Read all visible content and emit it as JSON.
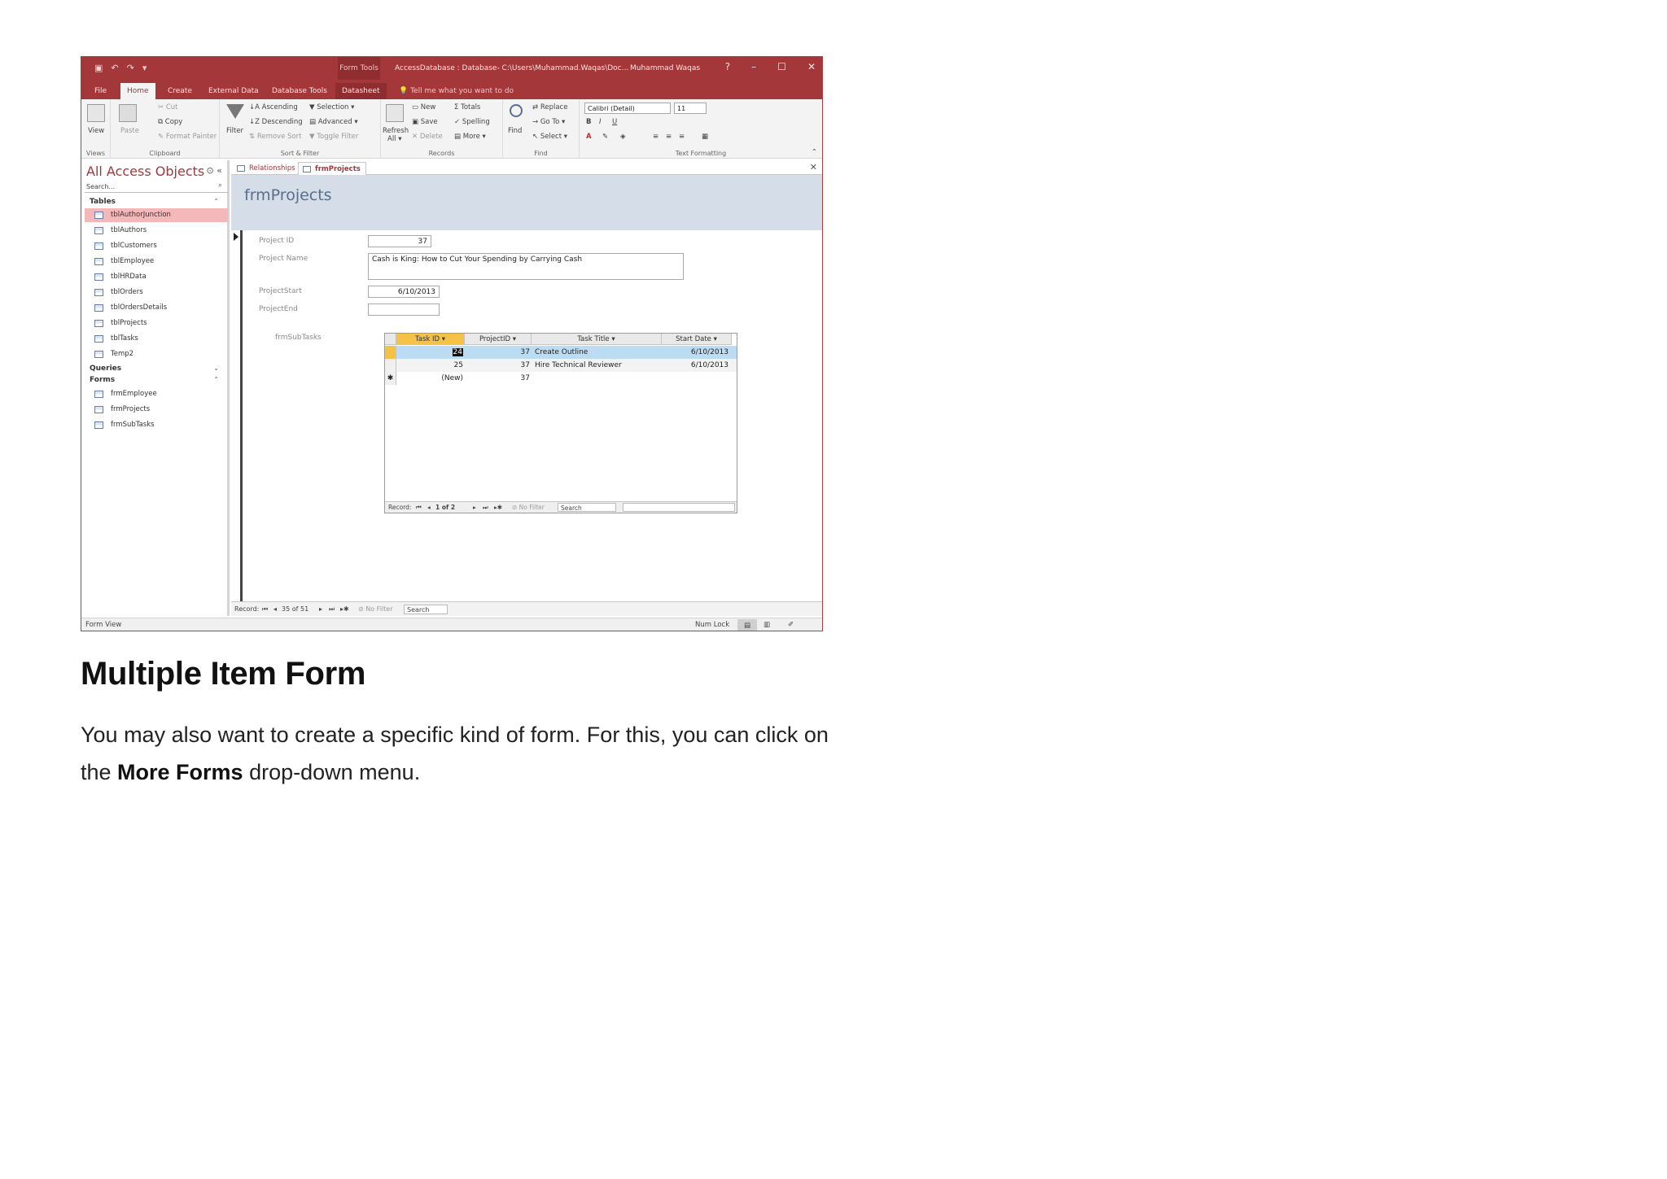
{
  "window": {
    "context_tab": "Form Tools",
    "title": "AccessDatabase : Database- C:\\Users\\Muhammad.Waqas\\Doc...",
    "user": "Muhammad Waqas",
    "help": "?",
    "minimize": "–",
    "maximize": "☐",
    "close": "✕"
  },
  "tabs": [
    {
      "label": "File"
    },
    {
      "label": "Home"
    },
    {
      "label": "Create"
    },
    {
      "label": "External Data"
    },
    {
      "label": "Database Tools"
    },
    {
      "label": "Datasheet"
    }
  ],
  "tell_me": "Tell me what you want to do",
  "ribbon": {
    "views": {
      "view": "View",
      "group": "Views"
    },
    "clipboard": {
      "paste": "Paste",
      "cut": "Cut",
      "copy": "Copy",
      "format_painter": "Format Painter",
      "group": "Clipboard"
    },
    "sort_filter": {
      "filter": "Filter",
      "ascending": "Ascending",
      "descending": "Descending",
      "remove_sort": "Remove Sort",
      "selection": "Selection ▾",
      "advanced": "Advanced ▾",
      "toggle_filter": "Toggle Filter",
      "group": "Sort & Filter"
    },
    "records": {
      "refresh": "Refresh",
      "refresh_all": "All ▾",
      "new": "New",
      "save": "Save",
      "delete": "Delete",
      "totals": "Totals",
      "spelling": "Spelling",
      "more": "More ▾",
      "group": "Records"
    },
    "find": {
      "find": "Find",
      "replace": "Replace",
      "go_to": "Go To ▾",
      "select": "Select ▾",
      "group": "Find"
    },
    "text_formatting": {
      "font": "Calibri (Detail)",
      "size": "11",
      "group": "Text Formatting"
    }
  },
  "nav": {
    "title": "All Access Objects",
    "search_placeholder": "Search...",
    "sections": {
      "tables": "Tables",
      "queries": "Queries",
      "forms": "Forms"
    },
    "tables": [
      "tblAuthorJunction",
      "tblAuthors",
      "tblCustomers",
      "tblEmployee",
      "tblHRData",
      "tblOrders",
      "tblOrdersDetails",
      "tblProjects",
      "tblTasks",
      "Temp2"
    ],
    "forms": [
      "frmEmployee",
      "frmProjects",
      "frmSubTasks"
    ]
  },
  "doc_tabs": [
    "Relationships",
    "frmProjects"
  ],
  "form": {
    "title": "frmProjects",
    "labels": {
      "project_id": "Project ID",
      "project_name": "Project Name",
      "project_start": "ProjectStart",
      "project_end": "ProjectEnd",
      "subform": "frmSubTasks"
    },
    "values": {
      "project_id": "37",
      "project_name": "Cash is King: How to Cut Your Spending by Carrying Cash",
      "project_start": "6/10/2013",
      "project_end": ""
    }
  },
  "subform": {
    "columns": [
      "Task ID",
      "ProjectID",
      "Task Title",
      "Start Date"
    ],
    "rows": [
      {
        "task_id": "24",
        "project_id": "37",
        "title": "Create Outline",
        "start": "6/10/2013"
      },
      {
        "task_id": "25",
        "project_id": "37",
        "title": "Hire Technical Reviewer",
        "start": "6/10/2013"
      },
      {
        "task_id": "(New)",
        "project_id": "37",
        "title": "",
        "start": ""
      }
    ],
    "nav": {
      "record": "Record:",
      "position": "1 of 2",
      "filter": "No Filter",
      "search": "Search"
    }
  },
  "record_nav": {
    "record": "Record:",
    "position": "35 of 51",
    "filter": "No Filter",
    "search": "Search"
  },
  "status": {
    "view": "Form View",
    "num_lock": "Num Lock"
  },
  "article": {
    "heading": "Multiple Item Form",
    "para_start": "You may also want to create a specific kind of form. For this, you can click on the ",
    "para_bold": "More Forms",
    "para_end": " drop-down menu."
  }
}
